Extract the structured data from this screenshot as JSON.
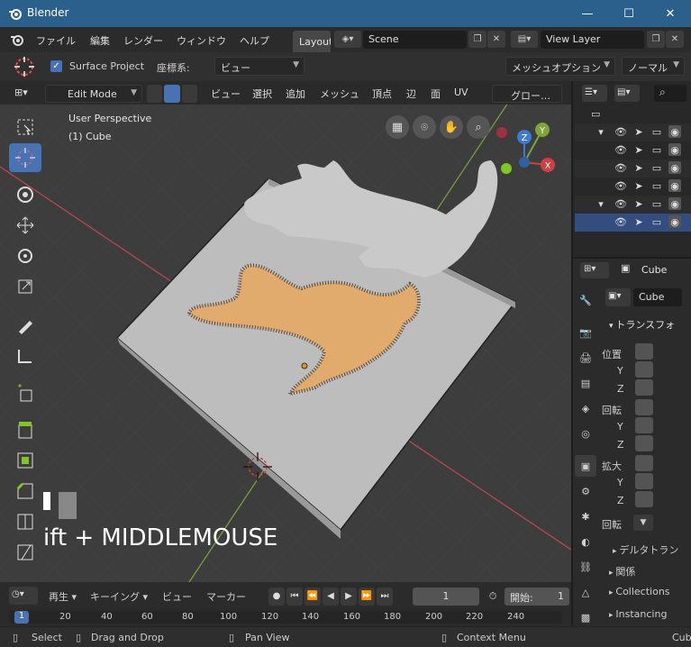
{
  "window": {
    "title": "Blender",
    "min": "—",
    "max": "☐",
    "close": "✕"
  },
  "menu": {
    "items": [
      "ファイル",
      "編集",
      "レンダー",
      "ウィンドウ",
      "ヘルプ"
    ],
    "workspace_tab": "Layout",
    "scene": "Scene",
    "view_layer": "View Layer"
  },
  "tool_options": {
    "checkbox_label": "Surface Project",
    "coord_label": "座標系:",
    "coord_value": "ビュー",
    "mesh_options": "メッシュオプション",
    "normal": "ノーマル"
  },
  "viewport_header": {
    "mode": "Edit Mode",
    "view": "ビュー",
    "select": "選択",
    "add": "追加",
    "mesh": "メッシュ",
    "vertex": "頂点",
    "edge": "辺",
    "face": "面",
    "uv": "UV",
    "transform": "グロー…"
  },
  "viewport": {
    "perspective": "User Perspective",
    "object": "(1) Cube",
    "overlay_text": "ift + MIDDLEMOUSE",
    "axes": {
      "x": "X",
      "y": "Y",
      "z": "Z"
    }
  },
  "properties": {
    "object_name": "Cube",
    "data_name": "Cube",
    "transform_header": "トランスフォ",
    "location": "位置",
    "rotation": "回転",
    "scale": "拡大",
    "y": "Y",
    "z": "Z",
    "rotation_mode": "回転",
    "delta": "デルタトラン",
    "relations": "関係",
    "collections": "Collections",
    "instancing": "Instancing"
  },
  "timeline": {
    "playback": "再生",
    "keying": "キーイング",
    "view": "ビュー",
    "marker": "マーカー",
    "current_frame": "1",
    "start_label": "開始:",
    "start_value": "1",
    "ticks": [
      "1",
      "20",
      "40",
      "60",
      "80",
      "100",
      "120",
      "140",
      "160",
      "180",
      "200",
      "220",
      "240"
    ]
  },
  "statusbar": {
    "select": "Select",
    "drag": "Drag and Drop",
    "pan": "Pan View",
    "context": "Context Menu",
    "right": "Cub"
  },
  "colors": {
    "accent": "#4772b3",
    "title_bar": "#2b5f8c",
    "selection_orange": "#e8a860"
  }
}
